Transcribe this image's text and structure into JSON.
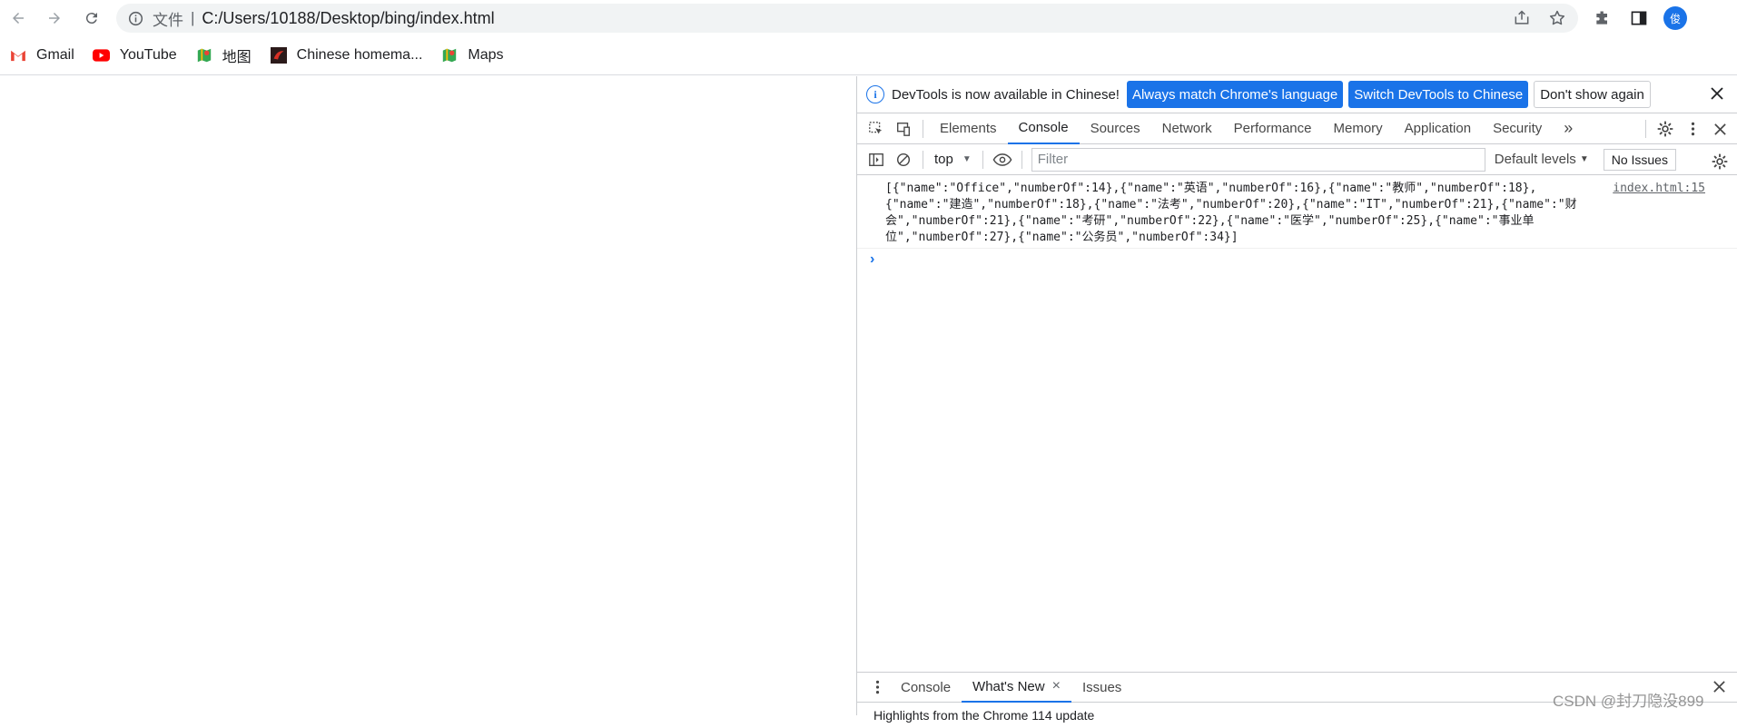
{
  "browser": {
    "scheme_label": "文件",
    "url": "C:/Users/10188/Desktop/bing/index.html",
    "avatar_letter": "俊",
    "accent": "#1a73e8"
  },
  "bookmarks": [
    {
      "label": "Gmail",
      "icon": "gmail-icon"
    },
    {
      "label": "YouTube",
      "icon": "youtube-icon"
    },
    {
      "label": "地图",
      "icon": "maps-icon"
    },
    {
      "label": "Chinese homema...",
      "icon": "site-favicon"
    },
    {
      "label": "Maps",
      "icon": "maps-icon"
    }
  ],
  "devtools": {
    "infobar": {
      "message": "DevTools is now available in Chinese!",
      "btn_match": "Always match Chrome's language",
      "btn_switch": "Switch DevTools to Chinese",
      "btn_dismiss": "Don't show again"
    },
    "tabs": [
      "Elements",
      "Console",
      "Sources",
      "Network",
      "Performance",
      "Memory",
      "Application",
      "Security"
    ],
    "active_tab": "Console",
    "more_tabs": "»",
    "console": {
      "context": "top",
      "filter_placeholder": "Filter",
      "levels": "Default levels",
      "issues": "No Issues",
      "log": {
        "text": "[{\"name\":\"Office\",\"numberOf\":14},{\"name\":\"英语\",\"numberOf\":16},{\"name\":\"教师\",\"numberOf\":18},\n{\"name\":\"建造\",\"numberOf\":18},{\"name\":\"法考\",\"numberOf\":20},{\"name\":\"IT\",\"numberOf\":21},{\"name\":\"财\n会\",\"numberOf\":21},{\"name\":\"考研\",\"numberOf\":22},{\"name\":\"医学\",\"numberOf\":25},{\"name\":\"事业单\n位\",\"numberOf\":27},{\"name\":\"公务员\",\"numberOf\":34}]",
        "source": "index.html:15"
      },
      "prompt": "›"
    },
    "drawer": {
      "tabs": [
        "Console",
        "What's New",
        "Issues"
      ],
      "active_tab": "What's New",
      "body": "Highlights from the Chrome 114 update"
    }
  },
  "watermark": "CSDN @封刀隐没899"
}
